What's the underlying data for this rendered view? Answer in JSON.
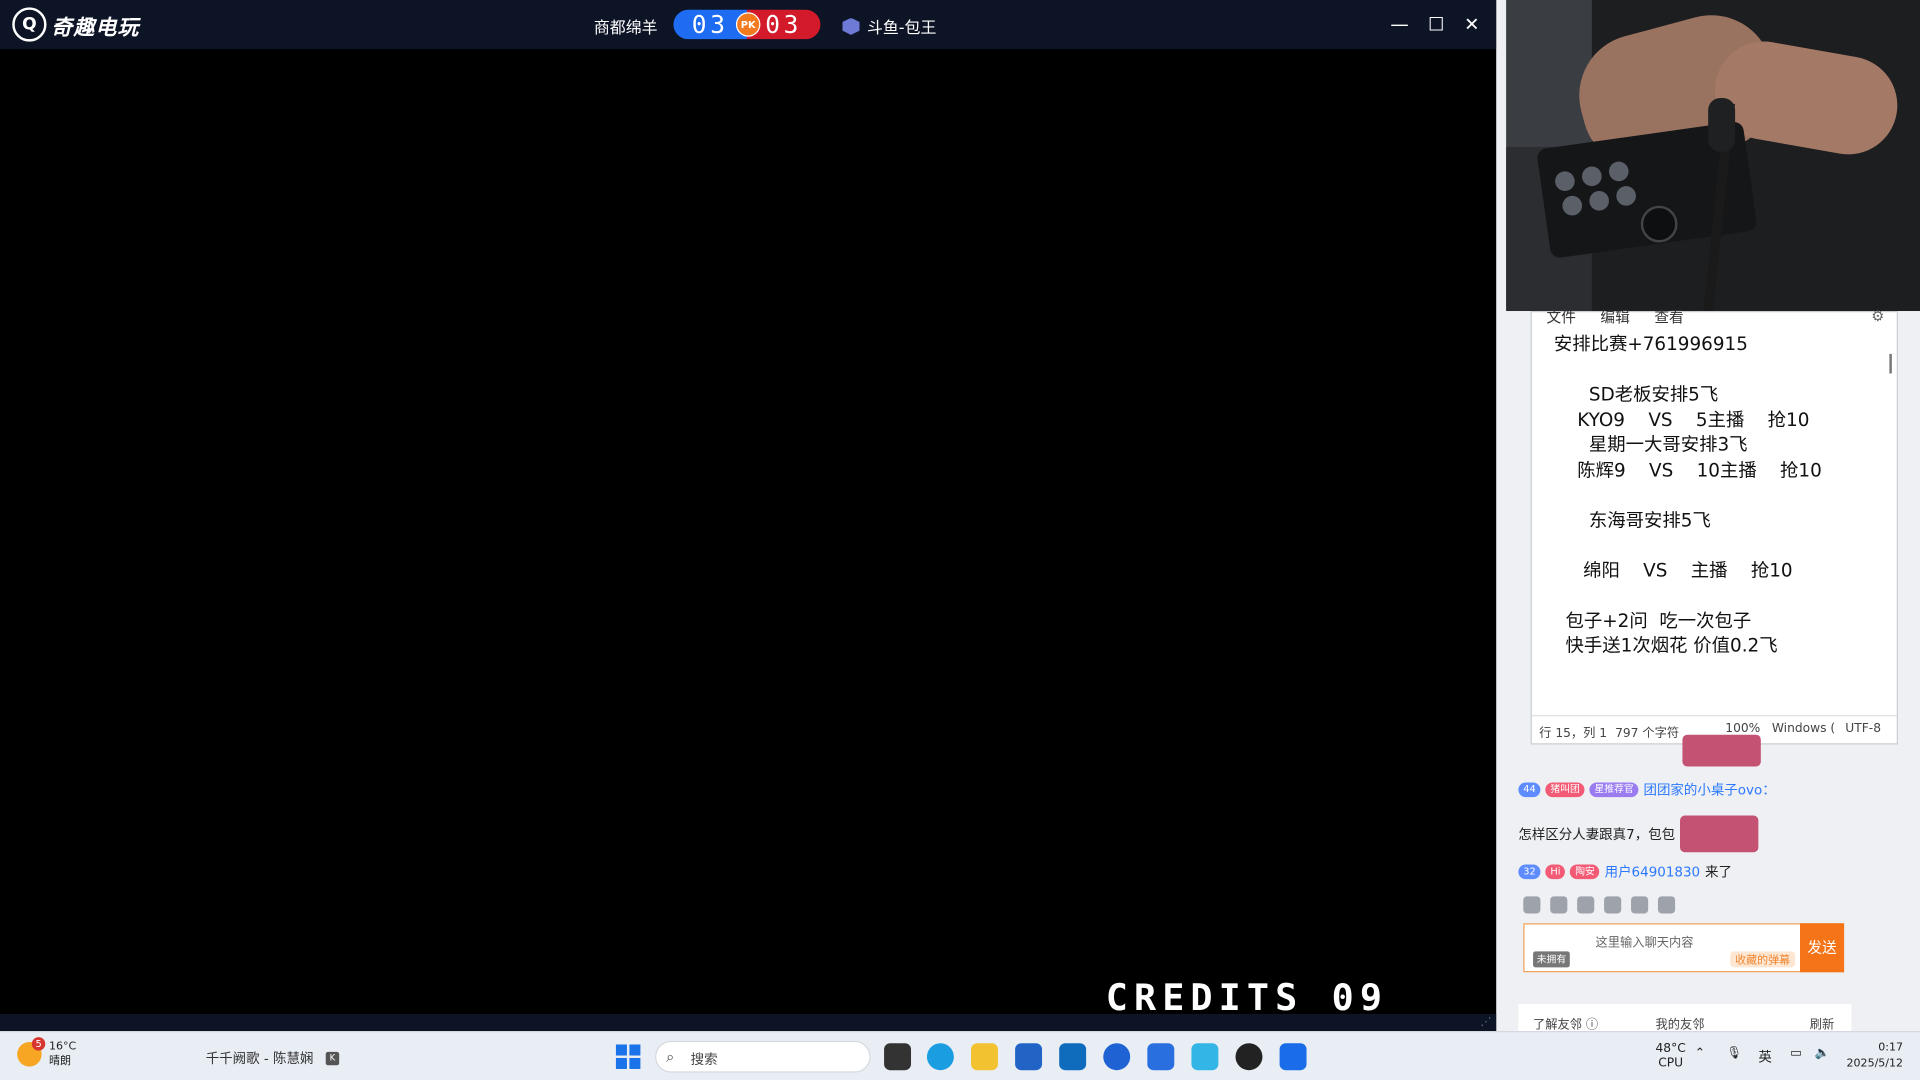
{
  "game_window": {
    "logo_text": "奇趣电玩",
    "player1": "商都绵羊",
    "score1": "03",
    "pk_label": "PK",
    "score2": "03",
    "player2": "斗鱼-包王",
    "credits": "CREDITS 09",
    "controls": {
      "minimize": "—",
      "maximize": "☐",
      "close": "✕"
    }
  },
  "notepad": {
    "menu": [
      "文件",
      "编辑",
      "查看"
    ],
    "content": "安排比赛+761996915\n\n      SD老板安排5飞\n    KYO9    VS    5主播    抢10\n      星期一大哥安排3飞\n    陈辉9    VS    10主播    抢10\n\n      东海哥安排5飞\n\n     绵阳    VS    主播    抢10\n\n  包子+2问  吃一次包子\n  快手送1次烟花 价值0.2飞",
    "status": {
      "position": "行 15，列 1",
      "chars": "797 个字符",
      "zoom": "100%",
      "eol": "Windows (",
      "encoding": "UTF-8"
    }
  },
  "chat": {
    "messages": [
      {
        "level": "44",
        "badge": "猪叫团",
        "badge2": "星推荐官",
        "user": "团团家的小桌子ovo：",
        "text": ""
      },
      {
        "text": "怎样区分人妻跟真7，包包"
      },
      {
        "level": "32",
        "badge": "Hi",
        "badge2": "陶安",
        "user": "用户64901830",
        "text": "来了"
      }
    ],
    "input_placeholder": "这里输入聊天内容",
    "input_left_label": "未拥有",
    "collect_label": "收藏的弹幕",
    "send_label": "发送",
    "friends_left": "了解友邻 ⓘ",
    "friends_mid": "我的友邻",
    "friends_right": "刷新"
  },
  "taskbar": {
    "weather_temp": "16°C",
    "weather_desc": "晴朗",
    "notif_count": "5",
    "music": "千千阙歌 - 陈慧娴",
    "search_placeholder": "搜索",
    "cpu_temp": "48°C",
    "cpu_label": "CPU",
    "ime": "英",
    "time": "0:17",
    "date": "2025/5/12"
  }
}
